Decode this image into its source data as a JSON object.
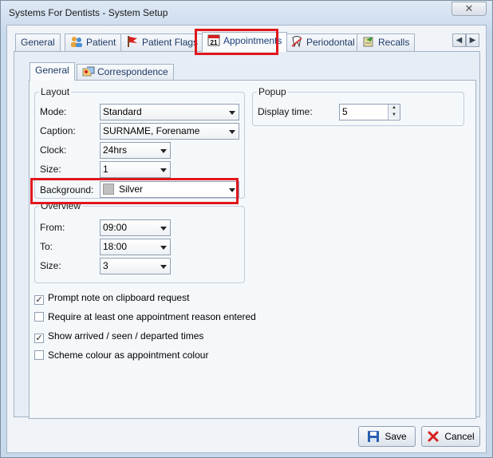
{
  "window": {
    "title": "Systems For Dentists - System Setup",
    "close_glyph": "✕"
  },
  "tabs": [
    {
      "label": "General",
      "icon": "none"
    },
    {
      "label": "Patient",
      "icon": "people-icon"
    },
    {
      "label": "Patient Flags",
      "icon": "flag-icon"
    },
    {
      "label": "Appointments",
      "icon": "calendar-icon",
      "active": true
    },
    {
      "label": "Periodontal",
      "icon": "tooth-icon"
    },
    {
      "label": "Recalls",
      "icon": "recall-icon"
    }
  ],
  "tab_nav": {
    "prev": "◀",
    "next": "▶"
  },
  "subtabs": [
    {
      "label": "General",
      "active": true
    },
    {
      "label": "Correspondence",
      "icon": "correspondence-icon"
    }
  ],
  "layout": {
    "title": "Layout",
    "mode_label": "Mode:",
    "mode_value": "Standard",
    "caption_label": "Caption:",
    "caption_value": "SURNAME, Forename",
    "clock_label": "Clock:",
    "clock_value": "24hrs",
    "size_label": "Size:",
    "size_value": "1",
    "background_label": "Background:",
    "background_value": "Silver",
    "background_color": "#c0c0c0"
  },
  "overview": {
    "title": "Overview",
    "from_label": "From:",
    "from_value": "09:00",
    "to_label": "To:",
    "to_value": "18:00",
    "size_label": "Size:",
    "size_value": "3"
  },
  "popup": {
    "title": "Popup",
    "display_time_label": "Display time:",
    "display_time_value": "5"
  },
  "options": [
    {
      "label": "Prompt note on clipboard request",
      "checked": true
    },
    {
      "label": "Require at least one appointment reason entered",
      "checked": false
    },
    {
      "label": "Show arrived / seen / departed times",
      "checked": true
    },
    {
      "label": "Scheme colour as appointment colour",
      "checked": false
    }
  ],
  "buttons": {
    "save": "Save",
    "cancel": "Cancel"
  },
  "colors": {
    "highlight": "#e0171c",
    "tab_text": "#1d3a66"
  }
}
